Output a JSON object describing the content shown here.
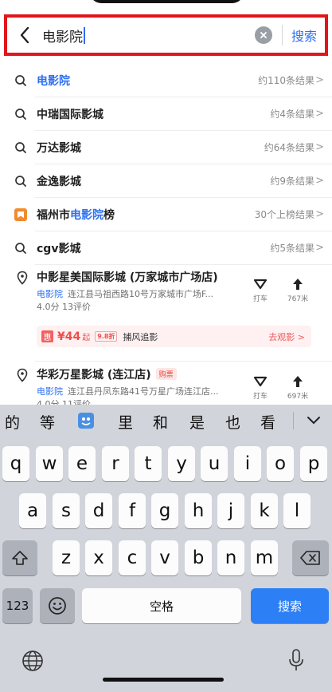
{
  "search": {
    "query": "电影院",
    "button_label": "搜索"
  },
  "suggestions": [
    {
      "label": "电影院",
      "count": "约110条结果",
      "highlight": true
    },
    {
      "label": "中瑞国际影城",
      "count": "约4条结果",
      "highlight": false
    },
    {
      "label": "万达影城",
      "count": "约64条结果",
      "highlight": false
    },
    {
      "label": "金逸影城",
      "count": "约9条结果",
      "highlight": false
    }
  ],
  "ranking": {
    "prefix": "福州市",
    "highlight": "电影院",
    "suffix": "榜",
    "count": "30个上榜结果"
  },
  "suggestion_cgv": {
    "label": "cgv影城",
    "count": "约5条结果"
  },
  "arrow": ">",
  "pois": [
    {
      "title": "中影星美国际影城 (万家城市广场店)",
      "tag": "电影院",
      "address": "连江县马祖西路10号万家城市广场F...",
      "rating": "4.0分  13评价",
      "taxi_label": "打车",
      "distance": "767米",
      "promo": {
        "icon_text": "惠",
        "price": "¥44",
        "price_suffix": "起",
        "discount": "9.8折",
        "film": "捕风追影",
        "action": "去观影 >"
      }
    },
    {
      "title": "华彩万星影城 (连江店)",
      "badge": "购票",
      "tag": "电影院",
      "address": "连江县丹凤东路41号万星广场连江店...",
      "rating": "4.0分  11评价",
      "taxi_label": "打车",
      "distance": "697米"
    }
  ],
  "keyboard": {
    "candidates": [
      "的",
      "等",
      "里",
      "和",
      "是",
      "也",
      "看"
    ],
    "row1": [
      "q",
      "w",
      "e",
      "r",
      "t",
      "y",
      "u",
      "i",
      "o",
      "p"
    ],
    "row2": [
      "a",
      "s",
      "d",
      "f",
      "g",
      "h",
      "j",
      "k",
      "l"
    ],
    "row3": [
      "z",
      "x",
      "c",
      "v",
      "b",
      "n",
      "m"
    ],
    "num_label": "123",
    "space_label": "空格",
    "search_label": "搜索"
  },
  "colors": {
    "accent_blue": "#2d6ff2",
    "highlight_border": "#e0161b",
    "promo_red": "#f04e4e"
  }
}
